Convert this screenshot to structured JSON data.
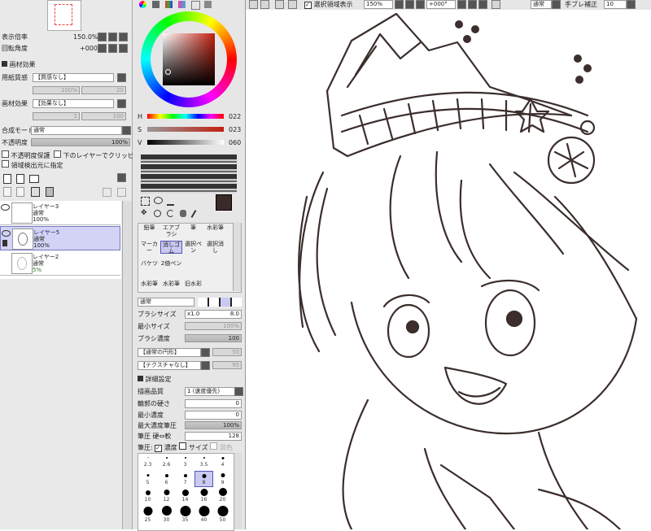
{
  "left": {
    "zoom_label": "表示倍率",
    "zoom_value": "150.0%",
    "rotate_label": "回転角度",
    "rotate_value": "+000°",
    "texture_header": "画材効果",
    "paper_label": "用紙質感",
    "paper_value": "【質感なし】",
    "paper_scale": "100%",
    "paper_strength": "20",
    "effect_label": "画材効果",
    "effect_value": "【効果なし】",
    "effect_width": "1",
    "effect_strength": "100",
    "blend_label": "合成モード",
    "blend_value": "通常",
    "opacity_label": "不透明度",
    "opacity_value": "100%",
    "protect_label": "不透明度保護",
    "clip_label": "下のレイヤーでクリッピング",
    "select_src_label": "領域検出元に指定",
    "layers": [
      {
        "name": "レイヤー3",
        "mode": "通常",
        "opacity": "100%"
      },
      {
        "name": "レイヤー5",
        "mode": "通常",
        "opacity": "100%"
      },
      {
        "name": "レイヤー2",
        "mode": "通常",
        "opacity": "5%"
      }
    ]
  },
  "color": {
    "h_label": "H",
    "h_value": "022",
    "s_label": "S",
    "s_value": "023",
    "v_label": "V",
    "v_value": "060",
    "main_color": "#3a2a28"
  },
  "tools": {
    "row1": [
      "鉛筆",
      "エアブラシ",
      "筆",
      "水彩筆"
    ],
    "row2": [
      "マーカー",
      "消しゴム",
      "選択ペン",
      "選択消し"
    ],
    "row3": [
      "バケツ",
      "2値ペン",
      "",
      ""
    ],
    "row4": [
      "水彩筆",
      "水彩筆",
      "旧水彩",
      ""
    ]
  },
  "brush": {
    "blend_value": "通常",
    "size_label": "ブラシサイズ",
    "size_mult": "x1.0",
    "size_value": "8.0",
    "min_size_label": "最小サイズ",
    "min_size_value": "100%",
    "density_label": "ブラシ濃度",
    "density_value": "100",
    "shape_value": "【通常の円形】",
    "shape_strength": "50",
    "texture_value": "【テクスチャなし】",
    "texture_strength": "95",
    "detail_header": "詳細設定",
    "quality_label": "描画品質",
    "quality_value": "1 (速度優先)",
    "edge_label": "輪郭の硬さ",
    "edge_value": "0",
    "min_density_label": "最小濃度",
    "min_density_value": "0",
    "max_pressure_label": "最大濃度筆圧",
    "max_pressure_value": "100%",
    "pressure_label": "筆圧 硬⇔軟",
    "pressure_value": "128",
    "pressure_row_label": "筆圧:",
    "density_check": "濃度",
    "size_check": "サイズ",
    "blend_check": "混色",
    "dot_sizes": [
      "2.3",
      "2.6",
      "3",
      "3.5",
      "4",
      "5",
      "6",
      "7",
      "8",
      "9",
      "10",
      "12",
      "14",
      "16",
      "20",
      "25",
      "30",
      "35",
      "40",
      "50"
    ]
  },
  "topbar": {
    "selection_label": "選択領域表示",
    "zoom": "150%",
    "angle": "+000°",
    "mode": "通常",
    "stabilizer_label": "手ブレ補正",
    "stabilizer_value": "10"
  }
}
